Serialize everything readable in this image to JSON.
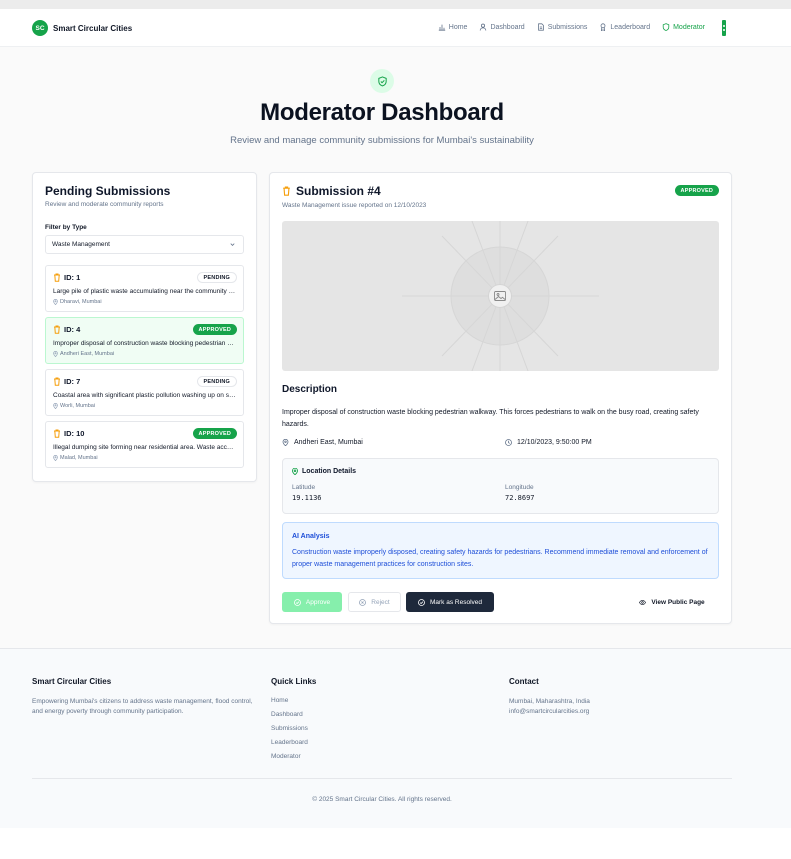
{
  "app": {
    "logo_initials": "SC",
    "name": "Smart Circular Cities"
  },
  "nav": {
    "items": [
      {
        "label": "Home",
        "icon": "bar-chart-icon"
      },
      {
        "label": "Dashboard",
        "icon": "user-icon"
      },
      {
        "label": "Submissions",
        "icon": "document-icon"
      },
      {
        "label": "Leaderboard",
        "icon": "award-icon"
      },
      {
        "label": "Moderator",
        "icon": "shield-icon",
        "active": true
      }
    ]
  },
  "hero": {
    "title": "Moderator Dashboard",
    "subtitle": "Review and manage community submissions for Mumbai's sustainability"
  },
  "pending": {
    "title": "Pending Submissions",
    "subtitle": "Review and moderate community reports",
    "filter_label": "Filter by Type",
    "filter_value": "Waste Management",
    "items": [
      {
        "id": "ID: 1",
        "status": "PENDING",
        "description": "Large pile of plastic waste accumulating near the community area",
        "location": "Dharavi, Mumbai"
      },
      {
        "id": "ID: 4",
        "status": "APPROVED",
        "description": "Improper disposal of construction waste blocking pedestrian walkway",
        "location": "Andheri East, Mumbai"
      },
      {
        "id": "ID: 7",
        "status": "PENDING",
        "description": "Coastal area with significant plastic pollution washing up on shore",
        "location": "Worli, Mumbai"
      },
      {
        "id": "ID: 10",
        "status": "APPROVED",
        "description": "Illegal dumping site forming near residential area. Waste accumulating",
        "location": "Malad, Mumbai"
      }
    ]
  },
  "detail": {
    "title": "Submission #4",
    "status": "APPROVED",
    "subtitle": "Waste Management issue reported on 12/10/2023",
    "description_title": "Description",
    "description": "Improper disposal of construction waste blocking pedestrian walkway. This forces pedestrians to walk on the busy road, creating safety hazards.",
    "location": "Andheri East, Mumbai",
    "datetime": "12/10/2023, 9:50:00 PM",
    "location_details": {
      "title": "Location Details",
      "latitude_label": "Latitude",
      "latitude": "19.1136",
      "longitude_label": "Longitude",
      "longitude": "72.8697"
    },
    "ai": {
      "title": "AI Analysis",
      "text": "Construction waste improperly disposed, creating safety hazards for pedestrians. Recommend immediate removal and enforcement of proper waste management practices for construction sites."
    },
    "actions": {
      "approve": "Approve",
      "reject": "Reject",
      "resolve": "Mark as Resolved",
      "view": "View Public Page"
    }
  },
  "footer": {
    "about_title": "Smart Circular Cities",
    "about_text": "Empowering Mumbai's citizens to address waste management, flood control, and energy poverty through community participation.",
    "links_title": "Quick Links",
    "links": [
      "Home",
      "Dashboard",
      "Submissions",
      "Leaderboard",
      "Moderator"
    ],
    "contact_title": "Contact",
    "contact_address": "Mumbai, Maharashtra, India",
    "contact_email": "info@smartcircularcities.org",
    "copyright": "© 2025 Smart Circular Cities. All rights reserved."
  },
  "colors": {
    "brand": "#16a34a",
    "dark_button": "#1e293b",
    "ai_accent": "#1d4ed8"
  }
}
